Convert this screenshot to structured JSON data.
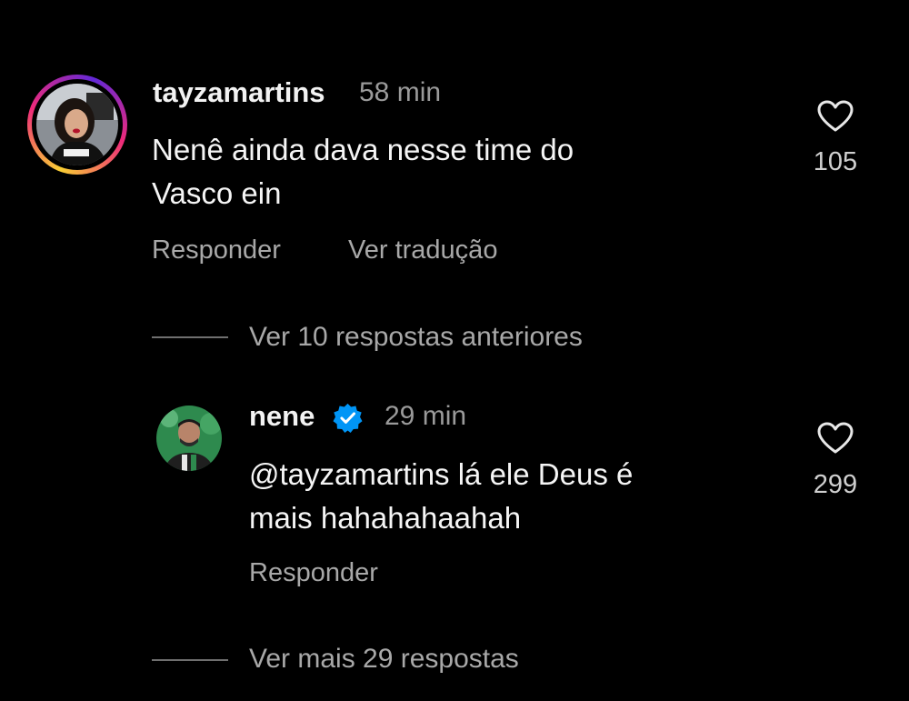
{
  "comments": [
    {
      "username": "tayzamartins",
      "time": "58 min",
      "text_line1": "Nenê ainda dava nesse time do",
      "text_line2": "Vasco ein",
      "likes": "105",
      "actions": {
        "reply": "Responder",
        "translate": "Ver tradução"
      },
      "avatar": "profile-photo-story-ring"
    },
    {
      "username": "nene",
      "verified": true,
      "time": "29 min",
      "text_line1": "@tayzamartins lá ele Deus é",
      "text_line2": "mais hahahahaahah",
      "likes": "299",
      "actions": {
        "reply": "Responder"
      },
      "avatar": "profile-photo"
    }
  ],
  "threads": {
    "previous_replies": "Ver 10 respostas anteriores",
    "more_replies": "Ver mais 29 respostas"
  },
  "colors": {
    "background": "#000000",
    "text": "#f5f5f5",
    "secondary": "#a8a8a8",
    "verified": "#0095f6"
  },
  "icons": [
    "heart-outline-icon",
    "verified-badge-icon"
  ]
}
